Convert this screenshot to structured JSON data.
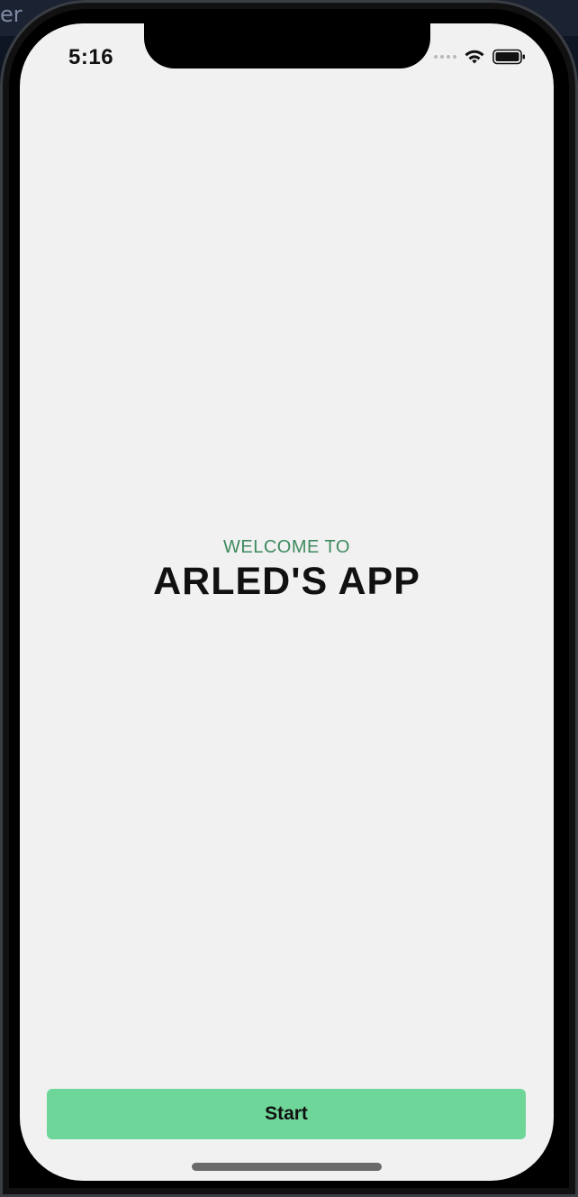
{
  "host": {
    "edge_text": "er"
  },
  "status_bar": {
    "time": "5:16",
    "wifi_icon": "wifi-icon",
    "battery_icon": "battery-icon"
  },
  "welcome": {
    "subtitle": "WELCOME TO",
    "title": "ARLED'S APP"
  },
  "start_button": {
    "label": "Start"
  },
  "colors": {
    "accent": "#6ed699",
    "subtitle": "#3e8a5f",
    "background": "#f1f1f1"
  }
}
